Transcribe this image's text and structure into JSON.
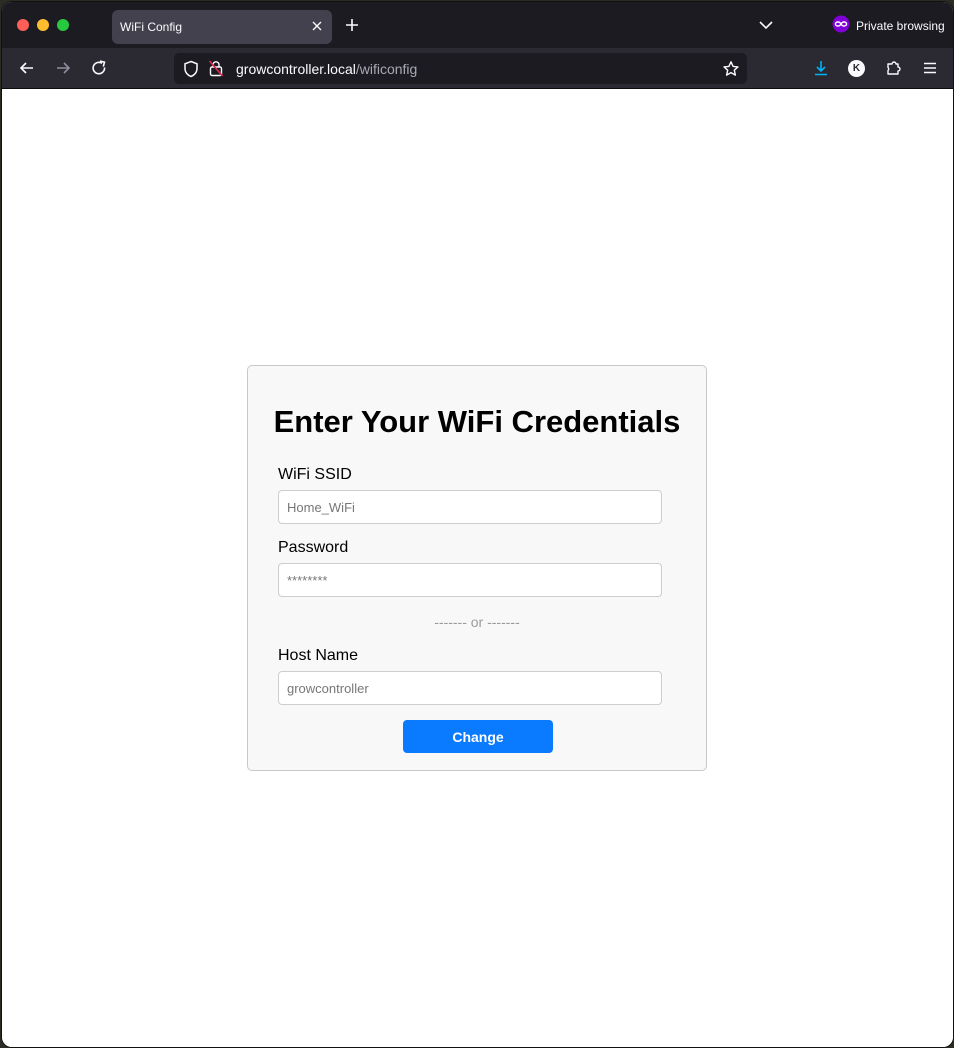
{
  "browser": {
    "tab_title": "WiFi Config",
    "private_label": "Private browsing",
    "url_host": "growcontroller.local",
    "url_path": "/wificonfig",
    "profile_initial": "K",
    "colors": {
      "tabstrip": "#1c1b22",
      "toolbar": "#2b2a33",
      "download_accent": "#00b3f4",
      "private_icon": "#8000d7"
    }
  },
  "form": {
    "title": "Enter Your WiFi Credentials",
    "ssid_label": "WiFi SSID",
    "ssid_placeholder": "Home_WiFi",
    "password_label": "Password",
    "password_placeholder": "********",
    "divider": "------- or -------",
    "hostname_label": "Host Name",
    "hostname_placeholder": "growcontroller",
    "submit_label": "Change",
    "colors": {
      "button": "#0a7bff",
      "card_background": "#f8f8f8"
    }
  }
}
